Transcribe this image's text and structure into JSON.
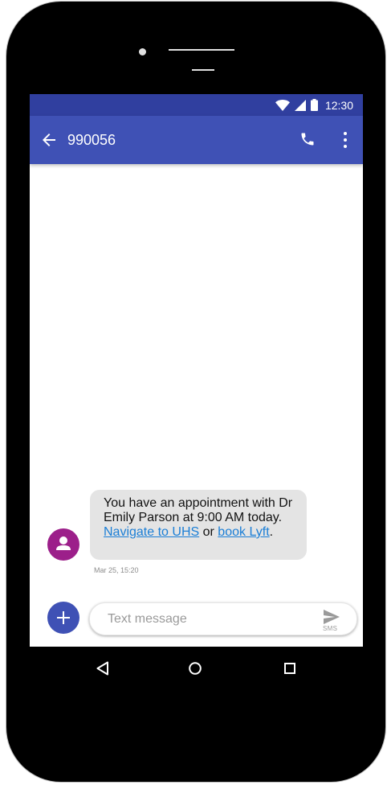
{
  "status_bar": {
    "time": "12:30",
    "icons": [
      "wifi-icon",
      "cell-signal-icon",
      "battery-icon"
    ]
  },
  "app_bar": {
    "title": "990056",
    "back_icon": "arrow-back-icon",
    "actions": [
      "phone-icon",
      "more-vert-icon"
    ]
  },
  "conversation": {
    "messages": [
      {
        "text_before": "You have an appointment with Dr Emily Parson at 9:00 AM today. ",
        "link1": "Navigate to UHS",
        "text_between": " or ",
        "link2": "book Lyft",
        "text_after": ".",
        "timestamp": "Mar 25, 15:20"
      }
    ]
  },
  "compose": {
    "placeholder": "Text message",
    "send_label": "SMS"
  },
  "nav_bar": {
    "icons": [
      "nav-back-icon",
      "nav-home-icon",
      "nav-recents-icon"
    ]
  },
  "colors": {
    "status_bar": "#303f9f",
    "app_bar": "#3f51b5",
    "avatar": "#9c1f8a",
    "bubble": "#e4e4e4",
    "link": "#1a7ed6"
  }
}
